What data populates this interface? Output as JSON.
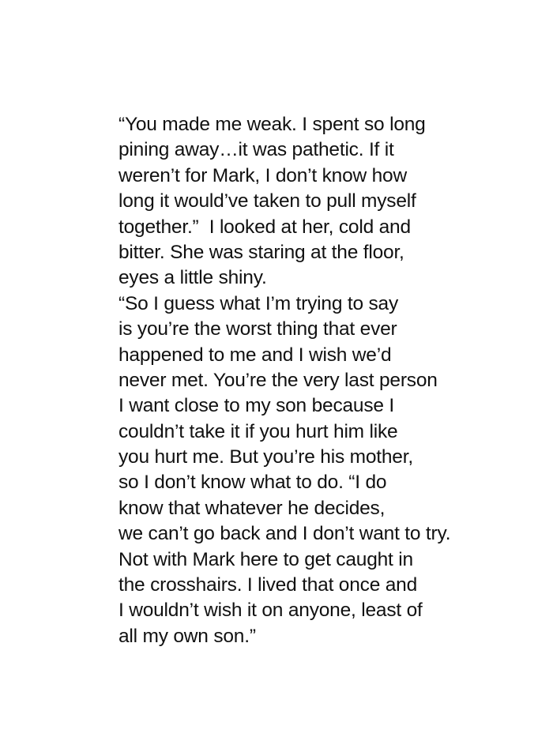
{
  "document": {
    "lines": [
      "“You made me weak. I spent so long",
      "pining away…it was pathetic. If it",
      "weren’t for Mark, I don’t know how",
      "long it would’ve taken to pull myself",
      "together.”  I looked at her, cold and",
      "bitter. She was staring at the floor,",
      "eyes a little shiny.",
      "“So I guess what I’m trying to say",
      "is you’re the worst thing that ever",
      "happened to me and I wish we’d",
      "never met. You’re the very last person",
      "I want close to my son because I",
      "couldn’t take it if you hurt him like",
      "you hurt me. But you’re his mother,",
      "so I don’t know what to do. “I do",
      "know that whatever he decides,",
      "we can’t go back and I don’t want to try.",
      "Not with Mark here to get caught in",
      "the crosshairs. I lived that once and",
      "I wouldn’t wish it on anyone, least of",
      "all my own son.”"
    ]
  }
}
